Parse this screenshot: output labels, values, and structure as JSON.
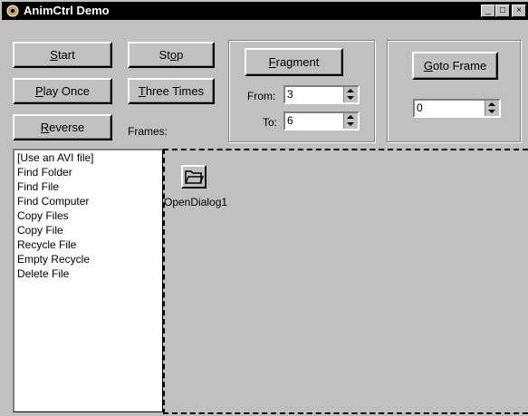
{
  "window": {
    "title": "AnimCtrl Demo",
    "minimize_glyph": "_",
    "maximize_glyph": "□",
    "close_glyph": "×"
  },
  "buttons": {
    "start": {
      "key": "S",
      "rest": "tart"
    },
    "stop": {
      "pre": "St",
      "key": "o",
      "rest": "p"
    },
    "play_once": {
      "key": "P",
      "rest": "lay Once"
    },
    "three_times": {
      "key": "T",
      "rest": "hree Times"
    },
    "reverse": {
      "key": "R",
      "rest": "everse"
    },
    "fragment": {
      "key": "F",
      "rest": "ragment"
    },
    "goto_frame": {
      "key": "G",
      "rest": "oto Frame"
    }
  },
  "labels": {
    "frames": "Frames:",
    "from": "From:",
    "to": "To:"
  },
  "spinners": {
    "from_value": "3",
    "to_value": "6",
    "goto_value": "0"
  },
  "list": {
    "items": [
      "[Use an AVI file]",
      "Find Folder",
      "Find File",
      "Find Computer",
      "Copy Files",
      "Copy File",
      "Recycle File",
      "Empty Recycle",
      "Delete File"
    ]
  },
  "canvas": {
    "component_label": "OpenDialog1",
    "component_icon": "open-folder-icon"
  }
}
